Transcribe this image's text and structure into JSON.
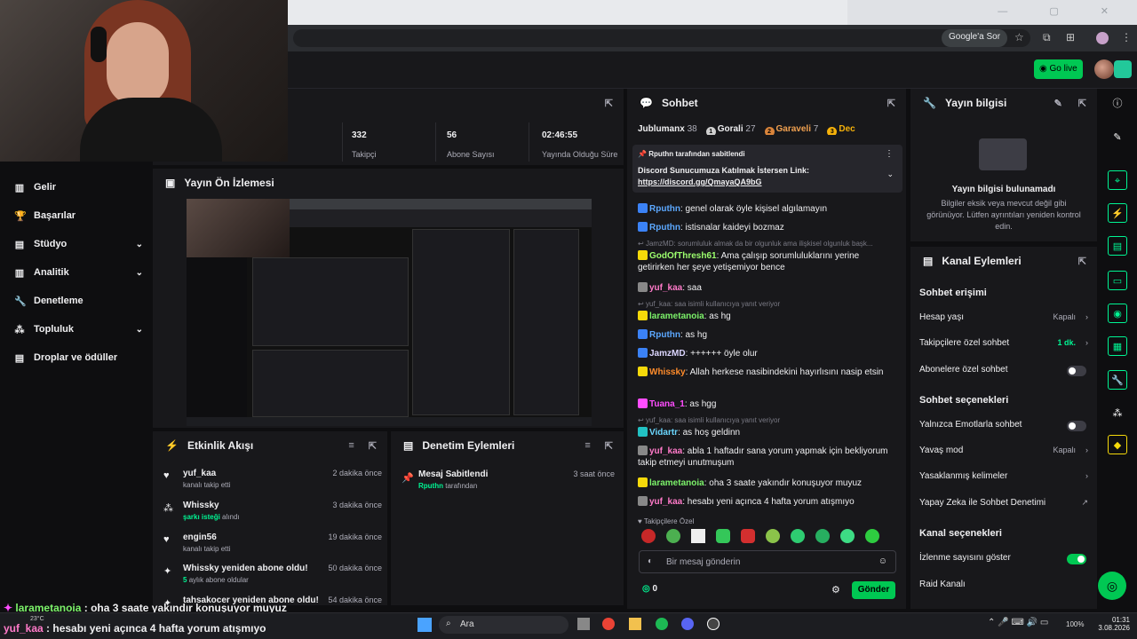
{
  "browser": {
    "google_btn": "Google'a Sor"
  },
  "header": {
    "go_live": "Go live"
  },
  "nav": {
    "items": [
      {
        "label": "Gelir",
        "icon": "bar-chart-icon"
      },
      {
        "label": "Başarılar",
        "icon": "trophy-icon"
      },
      {
        "label": "Stüdyo",
        "icon": "studio-icon",
        "chevron": true
      },
      {
        "label": "Analitik",
        "icon": "analytics-icon",
        "chevron": true
      },
      {
        "label": "Denetleme",
        "icon": "wrench-icon"
      },
      {
        "label": "Topluluk",
        "icon": "community-icon",
        "chevron": true
      },
      {
        "label": "Droplar ve ödüller",
        "icon": "drops-icon"
      }
    ]
  },
  "stats": {
    "followers_value": "332",
    "followers_label": "Takipçi",
    "subs_value": "56",
    "subs_label": "Abone Sayısı",
    "uptime_value": "02:46:55",
    "uptime_label": "Yayında Olduğu Süre"
  },
  "preview": {
    "title": "Yayın Ön İzlemesi"
  },
  "activity": {
    "title": "Etkinlik Akışı",
    "items": [
      {
        "name": "yuf_kaa",
        "sub": "kanalı takip etti",
        "sub_hl": "",
        "time": "2 dakika önce",
        "icon": "heart-icon"
      },
      {
        "name": "Whissky",
        "sub": "alındı",
        "sub_hl": "şarkı isteği",
        "time": "3 dakika önce",
        "icon": "channel-points-icon"
      },
      {
        "name": "engin56",
        "sub": "kanalı takip etti",
        "sub_hl": "",
        "time": "19 dakika önce",
        "icon": "heart-icon"
      },
      {
        "name": "Whissky yeniden abone oldu!",
        "sub": "aylık abone oldular",
        "sub_hl": "5",
        "time": "50 dakika önce",
        "icon": "star-icon"
      },
      {
        "name": "tahsakocer yeniden abone oldu!",
        "sub": "",
        "sub_hl": "",
        "time": "54 dakika önce",
        "icon": "star-icon"
      }
    ]
  },
  "moderation": {
    "title": "Denetim Eylemleri",
    "item_title": "Mesaj Sabitlendi",
    "item_user": "Rputhn",
    "item_suffix": "tarafından",
    "item_time": "3 saat önce"
  },
  "chat": {
    "title": "Sohbet",
    "leaderboard": [
      {
        "name": "Jublumanx",
        "value": "38"
      },
      {
        "name": "Gorali",
        "value": "27"
      },
      {
        "name": "Garaveli",
        "value": "7"
      },
      {
        "name": "Dec",
        "value": ""
      }
    ],
    "pinned_by": "Rputhn tarafından sabitlendi",
    "pinned_text": "Discord Sunucumuza Katılmak İstersen Link:",
    "pinned_link": "https://discord.gg/QmayaQA9bG",
    "messages": [
      {
        "user": "Rputhn",
        "color": "u-blue",
        "text": ": genel olarak öyle kişisel algılamayın"
      },
      {
        "user": "Rputhn",
        "color": "u-blue",
        "text": ": istisnalar kaideyi bozmaz"
      },
      {
        "reply": "JamzMD: sorumluluk almak da bir olgunluk ama ilişkisel olgunluk başk..."
      },
      {
        "user": "GodOfThresh61",
        "color": "u-lgreen",
        "text": ": Ama çalışıp sorumluluklarını yerine getirirken her şeye yetişemiyor bence"
      },
      {
        "user": "yuf_kaa",
        "color": "u-pink",
        "text": ": saa"
      },
      {
        "reply": "yuf_kaa: saa isimli kullanıcıya yanıt veriyor"
      },
      {
        "user": "larametanoia",
        "color": "u-green",
        "text": ": as hg"
      },
      {
        "user": "Rputhn",
        "color": "u-blue",
        "text": ": as hg"
      },
      {
        "user": "JamzMD",
        "color": "u-white",
        "text": ": ++++++ öyle olur"
      },
      {
        "user": "Whissky",
        "color": "u-orange",
        "text": ": Allah herkese nasibindekini hayırlısını nasip etsin"
      },
      {
        "user": "Tuana_1",
        "color": "u-magenta",
        "text": ": as hgg"
      },
      {
        "reply": "yuf_kaa: saa isimli kullanıcıya yanıt veriyor"
      },
      {
        "user": "Vidartr",
        "color": "u-lblue",
        "text": ": as hoş geldinn"
      },
      {
        "user": "yuf_kaa",
        "color": "u-pink",
        "text": ": abla 1 haftadır sana yorum yapmak için bekliyorum takip etmeyi unutmuşum"
      },
      {
        "user": "larametanoia",
        "color": "u-green",
        "text": ": oha 3 saate yakındır konuşuyor muyuz"
      },
      {
        "user": "yuf_kaa",
        "color": "u-pink",
        "text": ": hesabı yeni açınca 4 hafta yorum atışmıyo"
      }
    ],
    "followers_only": "Takipçilere Özel",
    "input_placeholder": "Bir mesaj gönderin",
    "points": "0",
    "send": "Gönder"
  },
  "stream_info": {
    "title": "Yayın bilgisi",
    "empty_title": "Yayın bilgisi bulunamadı",
    "empty_text": "Bilgiler eksik veya mevcut değil gibi görünüyor. Lütfen ayrıntıları yeniden kontrol edin."
  },
  "channel_actions": {
    "title": "Kanal Eylemleri",
    "chat_access": "Sohbet erişimi",
    "account_age": "Hesap yaşı",
    "account_age_val": "Kapalı",
    "followers_chat": "Takipçilere özel sohbet",
    "followers_chat_val": "1 dk.",
    "subs_chat": "Abonelere özel sohbet",
    "chat_options": "Sohbet seçenekleri",
    "emote_only": "Yalnızca Emotlarla sohbet",
    "slow_mode": "Yavaş mod",
    "slow_mode_val": "Kapalı",
    "banned_words": "Yasaklanmış kelimeler",
    "ai_mod": "Yapay Zeka ile Sohbet Denetimi",
    "channel_options": "Kanal seçenekleri",
    "show_viewers": "İzlenme sayısını göster",
    "raid": "Raid Kanalı"
  },
  "overlay": {
    "line1_user": "larametanoia",
    "line1_text": " : oha 3 saate yakındır konuşuyor muyuz",
    "line2_user": "yuf_kaa",
    "line2_text": " : hesabı yeni açınca 4 hafta yorum atışmıyo"
  },
  "taskbar": {
    "weather": "23°C",
    "search": "Ara",
    "battery": "100%",
    "time": "01:31",
    "date": "3.08.2026"
  }
}
